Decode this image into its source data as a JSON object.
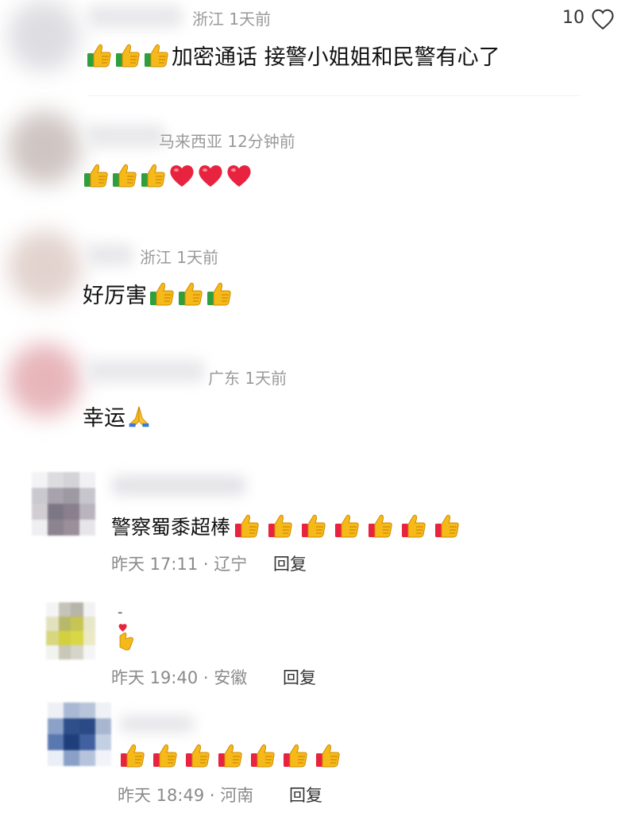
{
  "comments_top": [
    {
      "location_time": "浙江 1天前",
      "text": "加密通话 接警小姐姐和民警有心了",
      "like_count": "10"
    },
    {
      "location_time": "马来西亚 12分钟前",
      "text": ""
    },
    {
      "location_time": "浙江 1天前",
      "text": "好厉害"
    },
    {
      "location_time": "广东 1天前",
      "text": "幸运"
    }
  ],
  "comments_bottom": [
    {
      "text": "警察蜀黍超棒",
      "time": "昨天 17:11 · 辽宁",
      "reply_label": "回复"
    },
    {
      "name_fragment": "-",
      "time": "昨天 19:40 · 安徽",
      "reply_label": "回复"
    },
    {
      "time": "昨天 18:49 · 河南",
      "reply_label": "回复"
    }
  ],
  "icons": [
    "thumbs-up-icon",
    "red-heart-icon",
    "praying-hands-icon",
    "finger-heart-icon",
    "heart-outline-icon"
  ],
  "colors": {
    "thumb_yellow": "#f6b91a",
    "thumb_cuff": "#2f9e3c",
    "heart_red": "#e8233f",
    "meta_gray": "#9a9a9a"
  }
}
